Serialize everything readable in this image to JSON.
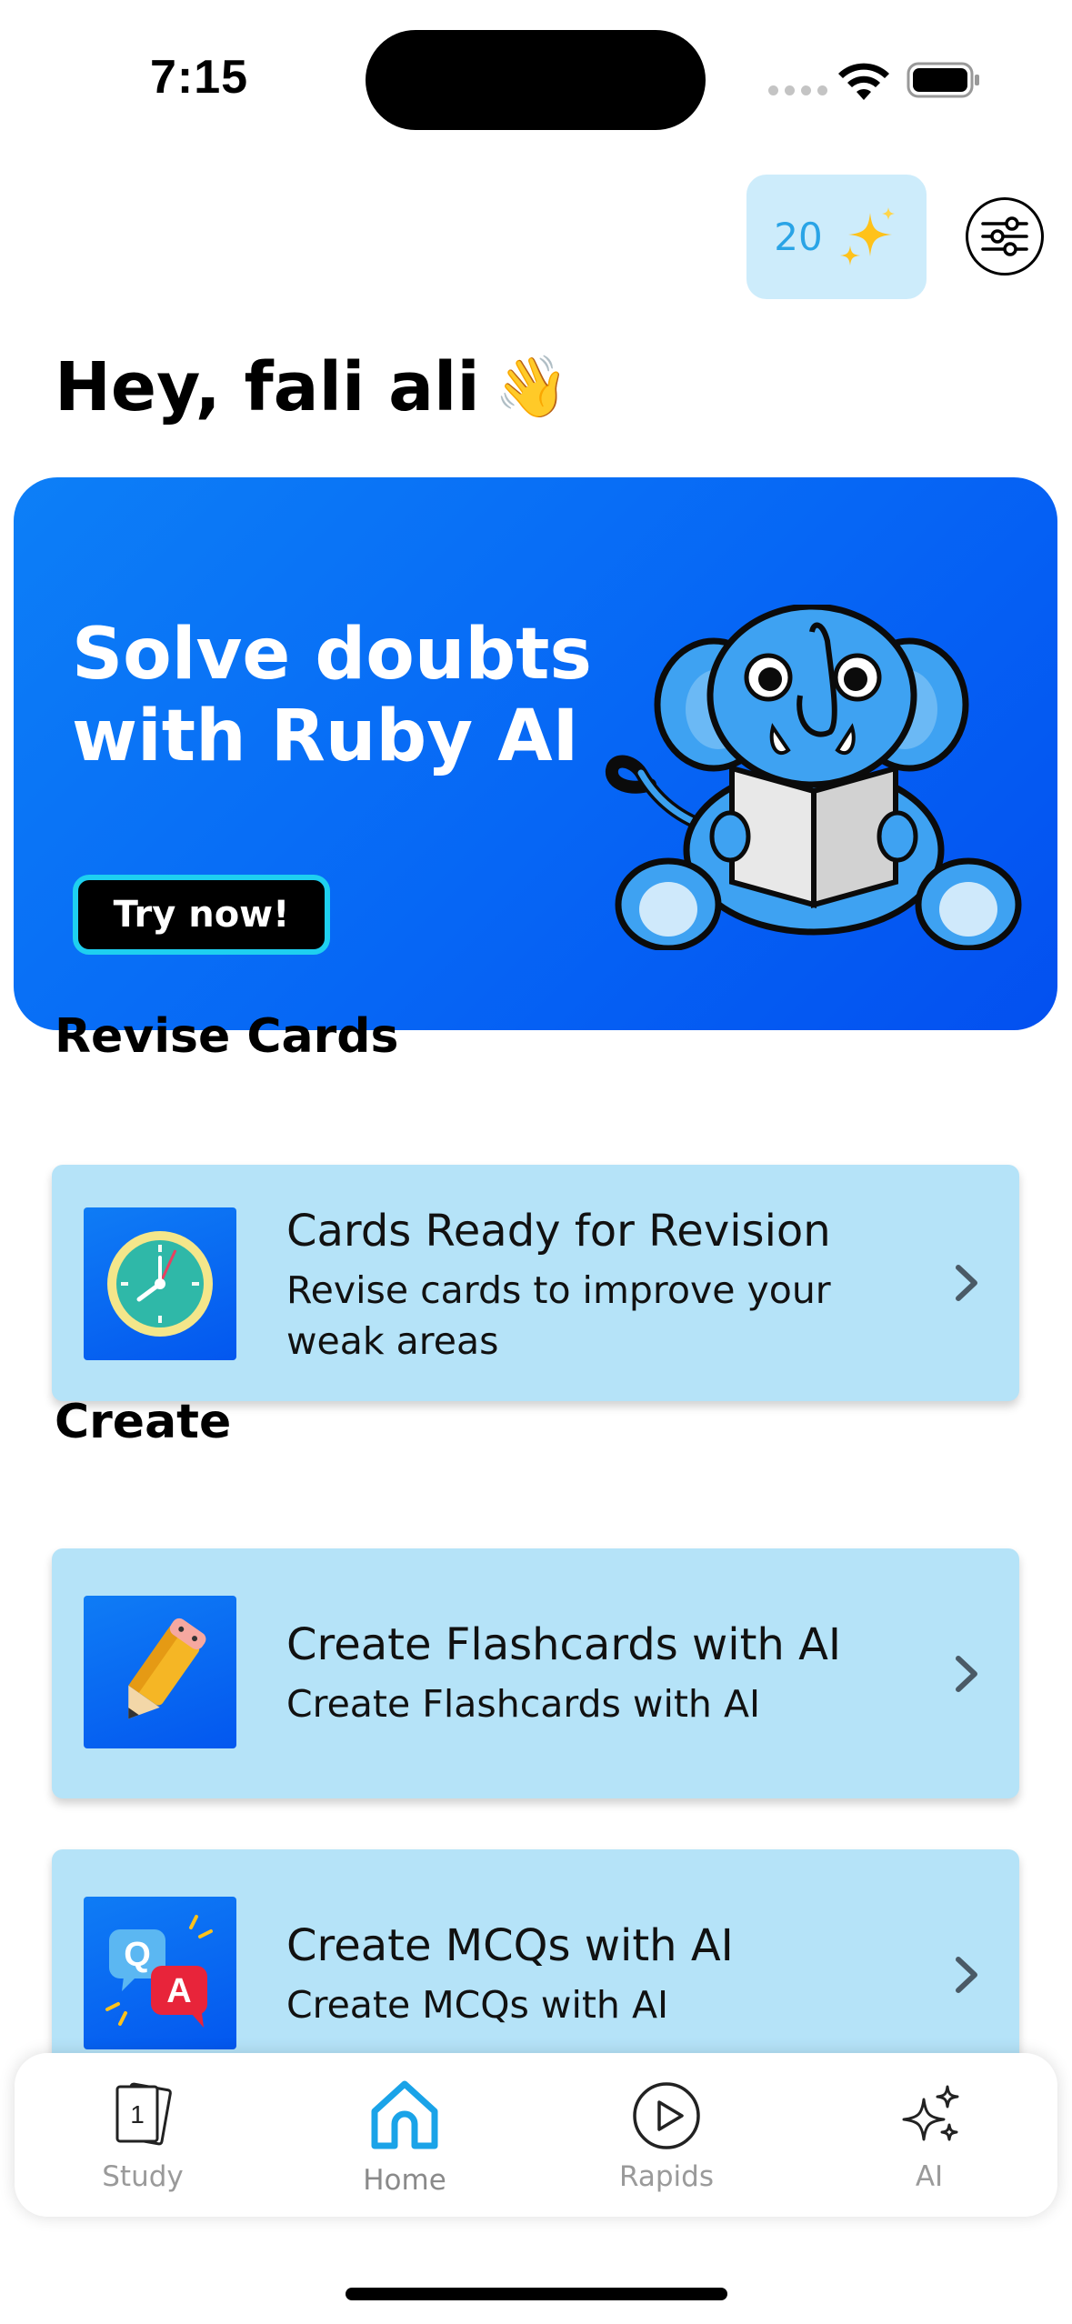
{
  "status_bar": {
    "time": "7:15"
  },
  "header": {
    "credits_count": "20",
    "credits_icon": "sparkles-icon",
    "settings_icon": "sliders-icon"
  },
  "greeting": {
    "text": "Hey, fali ali",
    "emoji": "👋"
  },
  "banner": {
    "title": "Solve doubts with Ruby AI",
    "button_label": "Try now!",
    "image": "elephant-mascot-reading"
  },
  "revise_section": {
    "title": "Revise Cards",
    "cards": [
      {
        "title": "Cards Ready for Revision",
        "subtitle": "Revise cards to improve your weak areas",
        "icon": "clock-icon"
      }
    ]
  },
  "create_section": {
    "title": "Create",
    "cards": [
      {
        "title": "Create Flashcards with AI",
        "subtitle": "Create Flashcards with AI",
        "icon": "pencil-icon"
      },
      {
        "title": "Create MCQs with AI",
        "subtitle": "Create MCQs with AI",
        "icon": "qa-icon",
        "icon_text_q": "Q",
        "icon_text_a": "A"
      }
    ]
  },
  "tabbar": {
    "items": [
      {
        "label": "Study",
        "icon": "cards-icon",
        "icon_text": "1"
      },
      {
        "label": "Home",
        "icon": "home-icon",
        "active": true
      },
      {
        "label": "Rapids",
        "icon": "play-circle-icon"
      },
      {
        "label": "AI",
        "icon": "sparkles-icon"
      }
    ]
  },
  "colors": {
    "accent": "#1aa3e8",
    "banner_blue": "#0666f5",
    "card_bg": "#b5e3f8",
    "credits_bg": "#cdecfb"
  }
}
